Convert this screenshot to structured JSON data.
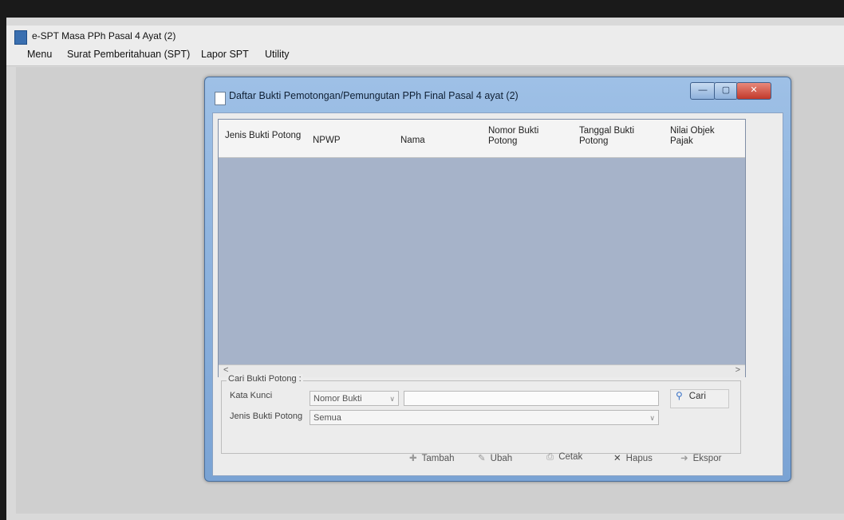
{
  "app": {
    "title": "e-SPT Masa PPh Pasal 4 Ayat (2)"
  },
  "menu": [
    "Menu",
    "Surat Pemberitahuan (SPT)",
    "Lapor SPT",
    "Utility"
  ],
  "dialog": {
    "title": "Daftar Bukti Pemotongan/Pemungutan PPh Final Pasal 4 ayat (2)",
    "columns": [
      "Jenis Bukti Potong",
      "NPWP",
      "Nama",
      "Nomor Bukti Potong",
      "Tanggal Bukti Potong",
      "Nilai Objek Pajak"
    ],
    "search": {
      "legend": "Cari Bukti Potong :",
      "keyword_label": "Kata Kunci",
      "keyword_option": "Nomor Bukti",
      "keyword_value": "",
      "type_label": "Jenis Bukti Potong",
      "type_option": "Semua",
      "cari_label": "Cari"
    },
    "buttons": {
      "tambah": "Tambah",
      "ubah": "Ubah",
      "cetak": "Cetak",
      "hapus": "Hapus",
      "ekspor": "Ekspor"
    }
  },
  "colors": {
    "title_bar": "#8eb1db",
    "grid_bg": "#a6b3c9",
    "close_red": "#c1392b"
  }
}
